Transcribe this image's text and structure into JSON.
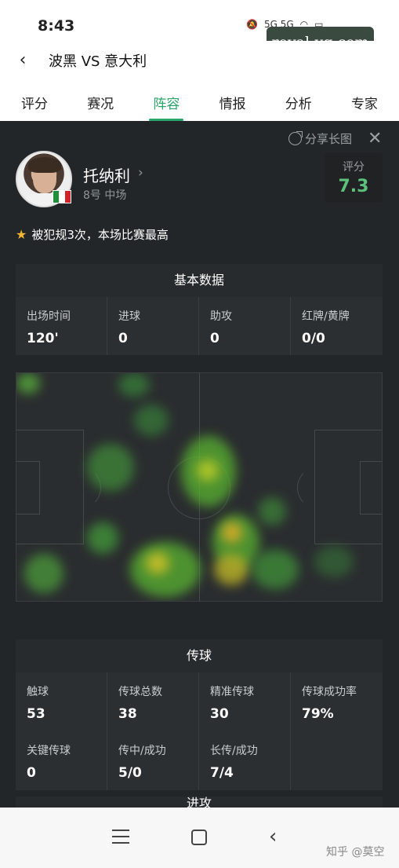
{
  "status_bar": {
    "time": "8:43",
    "icons": "5G 5G"
  },
  "watermark_top": "royal-vg.com",
  "header": {
    "back_icon": "chevron-left-icon",
    "title": "波黑 VS 意大利"
  },
  "tabs": [
    "评分",
    "赛况",
    "阵容",
    "情报",
    "分析",
    "专家"
  ],
  "active_tab": "阵容",
  "share": {
    "label": "分享长图"
  },
  "player": {
    "name": "托纳利",
    "position": "8号 中场",
    "rating_label": "评分",
    "rating": "7.3"
  },
  "note": "被犯规3次，本场比赛最高",
  "basic_stats": {
    "title": "基本数据",
    "items": [
      {
        "label": "出场时间",
        "value": "120'"
      },
      {
        "label": "进球",
        "value": "0"
      },
      {
        "label": "助攻",
        "value": "0"
      },
      {
        "label": "红牌/黄牌",
        "value": "0/0"
      }
    ]
  },
  "passing": {
    "title": "传球",
    "items": [
      {
        "label": "触球",
        "value": "53"
      },
      {
        "label": "传球总数",
        "value": "38"
      },
      {
        "label": "精准传球",
        "value": "30"
      },
      {
        "label": "传球成功率",
        "value": "79%"
      },
      {
        "label": "关键传球",
        "value": "0"
      },
      {
        "label": "传中/成功",
        "value": "5/0"
      },
      {
        "label": "长传/成功",
        "value": "7/4"
      }
    ]
  },
  "next_section_title": "进攻",
  "footer_mark": "知乎 @莫空",
  "colors": {
    "accent": "#2aa66b",
    "rating": "#5dc07b",
    "panel": "#232628"
  }
}
